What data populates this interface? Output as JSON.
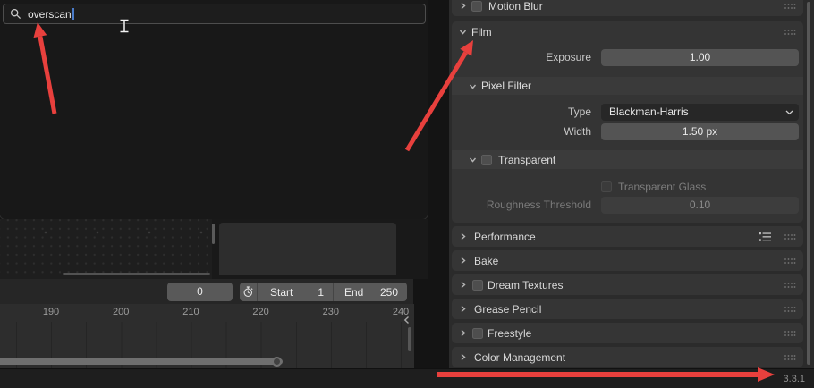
{
  "search_popup": {
    "query": "overscan"
  },
  "properties": {
    "motion_blur_label": "Motion Blur",
    "film": {
      "label": "Film",
      "exposure_label": "Exposure",
      "exposure_value": "1.00",
      "pixel_filter_label": "Pixel Filter",
      "type_label": "Type",
      "type_value": "Blackman-Harris",
      "width_label": "Width",
      "width_value": "1.50 px",
      "transparent_label": "Transparent",
      "transparent_glass_label": "Transparent Glass",
      "roughness_label": "Roughness Threshold",
      "roughness_value": "0.10"
    },
    "collapsed_panels": [
      {
        "label": "Performance",
        "checkbox": false,
        "presets": true
      },
      {
        "label": "Bake",
        "checkbox": false,
        "presets": false
      },
      {
        "label": "Dream Textures",
        "checkbox": true,
        "presets": false
      },
      {
        "label": "Grease Pencil",
        "checkbox": false,
        "presets": false
      },
      {
        "label": "Freestyle",
        "checkbox": true,
        "presets": false
      },
      {
        "label": "Color Management",
        "checkbox": false,
        "presets": false
      }
    ]
  },
  "timeline": {
    "frame_value": "0",
    "start_label": "Start",
    "start_value": "1",
    "end_label": "End",
    "end_value": "250",
    "ruler_ticks": [
      "190",
      "200",
      "210",
      "220",
      "230",
      "240"
    ]
  },
  "status_bar": {
    "version": "3.3.1"
  },
  "colors": {
    "annotation_red": "#e8403d",
    "caret_blue": "#4a7bc8"
  }
}
